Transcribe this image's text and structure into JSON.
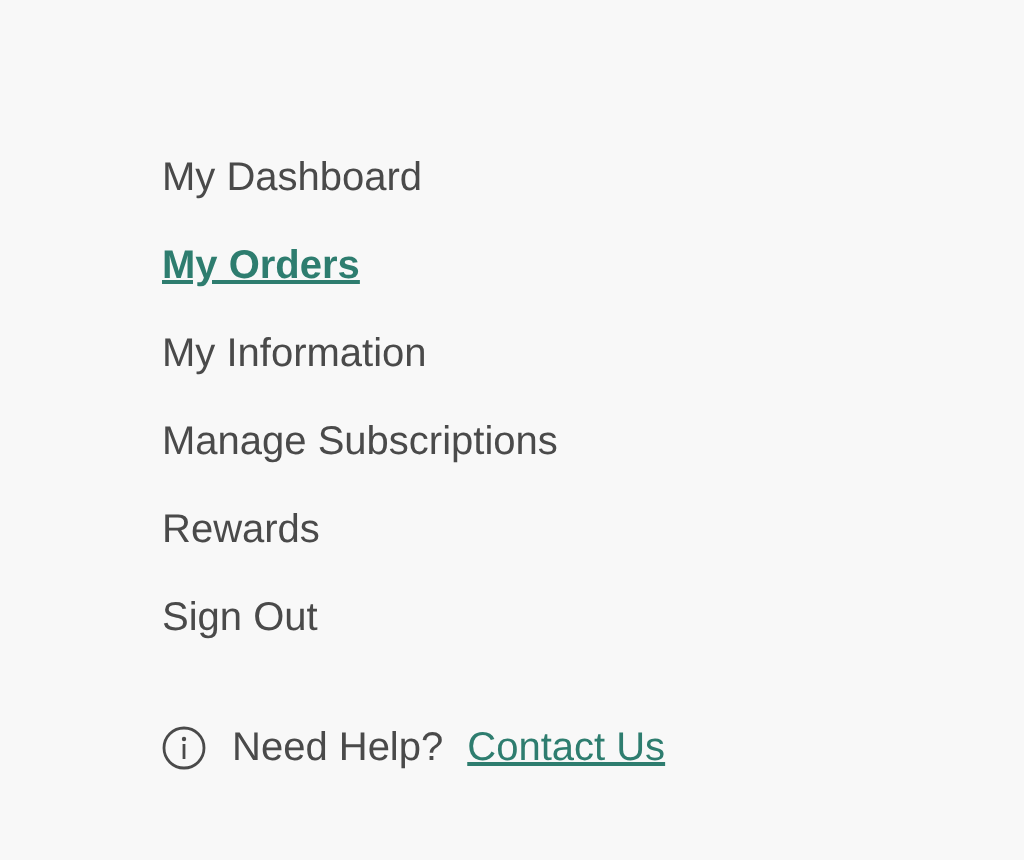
{
  "nav": {
    "items": [
      {
        "label": "My Dashboard",
        "selected": false
      },
      {
        "label": "My Orders",
        "selected": true
      },
      {
        "label": "My Information",
        "selected": false
      },
      {
        "label": "Manage Subscriptions",
        "selected": false
      },
      {
        "label": "Rewards",
        "selected": false
      },
      {
        "label": "Sign Out",
        "selected": false
      }
    ]
  },
  "help": {
    "label": "Need Help?",
    "link": "Contact Us"
  }
}
